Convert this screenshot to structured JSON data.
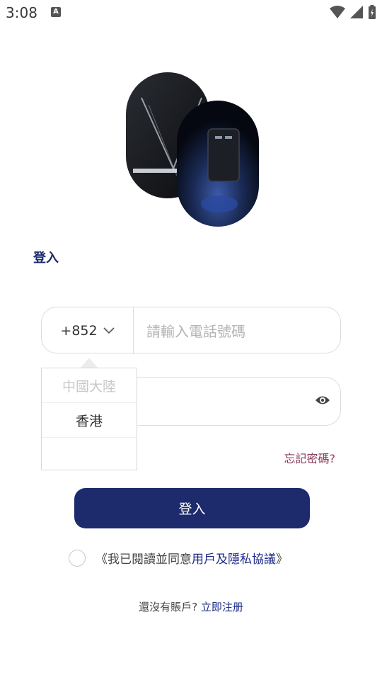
{
  "status_bar": {
    "time": "3:08",
    "notif_badge": "A"
  },
  "login": {
    "title": "登入",
    "country_code": "+852",
    "phone_placeholder": "請輸入電話號碼",
    "forgot_password": "忘記密碼?",
    "submit_label": "登入",
    "agreement_prefix": "《我已閱讀並同意",
    "agreement_link": "用戶及隱私協議",
    "agreement_suffix": "》",
    "register_prompt": "還沒有賬戶?",
    "register_link": "立即注册"
  },
  "country_dropdown": {
    "options": [
      "中國大陸",
      "香港"
    ]
  },
  "colors": {
    "brand": "#1d2a6b",
    "forgot": "#8a3a5a",
    "link": "#1d2a8a"
  }
}
